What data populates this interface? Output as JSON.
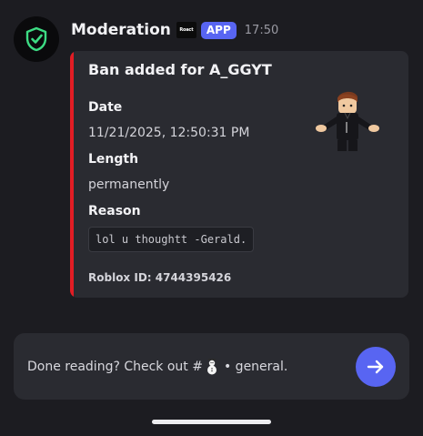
{
  "message": {
    "author": "Moderation",
    "server_tag_text": "Roact",
    "app_badge": "APP",
    "time": "17:50",
    "avatar_icon": "shield-check-icon",
    "embed": {
      "accent_color": "#e11d24",
      "title": "Ban added for A_GGYT",
      "fields": [
        {
          "name": "Date",
          "value": "11/21/2025, 12:50:31 PM"
        },
        {
          "name": "Length",
          "value": "permanently"
        },
        {
          "name": "Reason",
          "value": "lol u thoughtt -Gerald."
        }
      ],
      "footer": "Roblox ID: 4744395426",
      "thumbnail_icon": "roblox-avatar-icon"
    }
  },
  "prompt": {
    "prefix": "Done reading? Check out #",
    "channel_icon": "snowman-icon",
    "suffix": "• general.",
    "button_icon": "arrow-right-icon"
  },
  "colors": {
    "background": "#1c1c21",
    "card": "#2a2b31",
    "blurple": "#5865f2",
    "shield_green": "#3ddc84"
  }
}
